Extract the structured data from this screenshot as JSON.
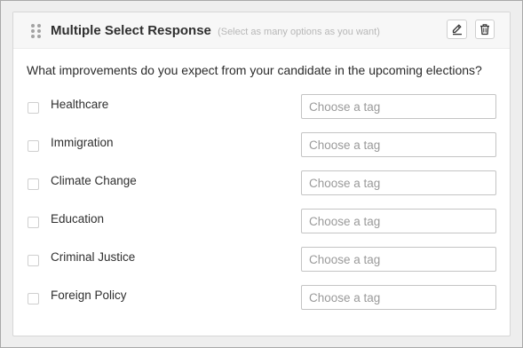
{
  "header": {
    "title": "Multiple Select Response",
    "subtitle": "(Select as many options as you want)",
    "edit_icon": "pencil-icon",
    "delete_icon": "trash-icon",
    "drag_icon": "drag-handle-icon"
  },
  "question": "What improvements do you expect from your candidate in the upcoming elections?",
  "options": [
    {
      "label": "Healthcare",
      "checked": false,
      "tag_placeholder": "Choose a tag"
    },
    {
      "label": "Immigration",
      "checked": false,
      "tag_placeholder": "Choose a tag"
    },
    {
      "label": "Climate Change",
      "checked": false,
      "tag_placeholder": "Choose a tag"
    },
    {
      "label": "Education",
      "checked": false,
      "tag_placeholder": "Choose a tag"
    },
    {
      "label": "Criminal Justice",
      "checked": false,
      "tag_placeholder": "Choose a tag"
    },
    {
      "label": "Foreign Policy",
      "checked": false,
      "tag_placeholder": "Choose a tag"
    }
  ]
}
